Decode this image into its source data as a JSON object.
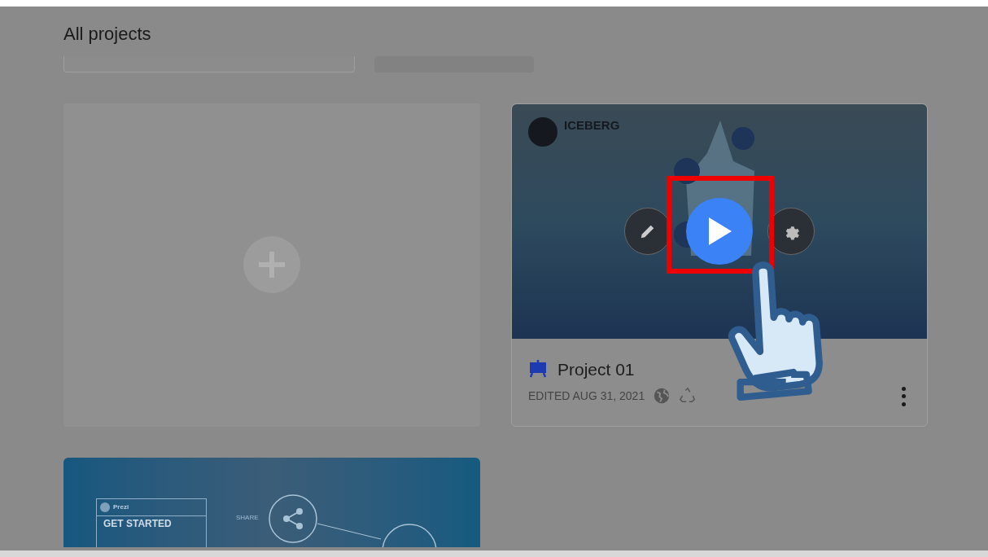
{
  "page": {
    "title": "All projects"
  },
  "projects": [
    {
      "kind": "card",
      "thumbnail": {
        "kind": "iceberg",
        "heading": "ICEBERG"
      },
      "title": "Project 01",
      "edited": "EDITED AUG 31, 2021",
      "highlighted": true
    },
    {
      "kind": "thumbnail_only",
      "thumbnail": {
        "kind": "get_started",
        "brand": "Prezi",
        "heading": "GET STARTED",
        "label": "SHARE"
      }
    }
  ]
}
